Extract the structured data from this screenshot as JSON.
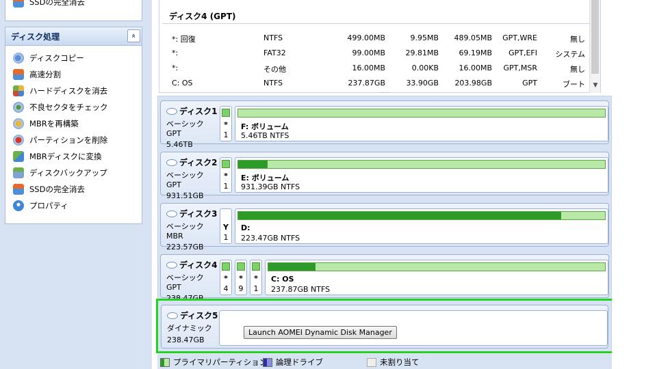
{
  "sidebar": {
    "top_item_label": "SSDの完全消去",
    "section_title": "ディスク処理",
    "collapse_glyph": "»",
    "items": [
      {
        "label": "ディスクコピー",
        "icon": "disk-copy-icon"
      },
      {
        "label": "高速分割",
        "icon": "quick-partition-icon"
      },
      {
        "label": "ハードディスクを消去",
        "icon": "wipe-disk-icon"
      },
      {
        "label": "不良セクタをチェック",
        "icon": "bad-sector-icon"
      },
      {
        "label": "MBRを再構築",
        "icon": "rebuild-mbr-icon"
      },
      {
        "label": "パーティションを削除",
        "icon": "delete-partition-icon"
      },
      {
        "label": "MBRディスクに変換",
        "icon": "convert-mbr-icon"
      },
      {
        "label": "ディスクバックアップ",
        "icon": "disk-backup-icon"
      },
      {
        "label": "SSDの完全消去",
        "icon": "ssd-erase-icon"
      },
      {
        "label": "プロパティ",
        "icon": "properties-icon"
      }
    ]
  },
  "partition_table": {
    "title": "ディスク4 (GPT)",
    "rows": [
      {
        "name": "*: 回復",
        "fs": "NTFS",
        "capacity": "499.00MB",
        "used": "9.95MB",
        "free": "489.05MB",
        "flag": "GPT,WRE",
        "status": "無し"
      },
      {
        "name": "*:",
        "fs": "FAT32",
        "capacity": "99.00MB",
        "used": "29.81MB",
        "free": "69.19MB",
        "flag": "GPT,EFI",
        "status": "システム"
      },
      {
        "name": "*:",
        "fs": "その他",
        "capacity": "16.00MB",
        "used": "0.00KB",
        "free": "16.00MB",
        "flag": "GPT,MSR",
        "status": "無し"
      },
      {
        "name": "C: OS",
        "fs": "NTFS",
        "capacity": "237.87GB",
        "used": "33.90GB",
        "free": "203.98GB",
        "flag": "GPT",
        "status": "ブート"
      }
    ]
  },
  "disks": [
    {
      "name": "ディスク1",
      "type": "ベーシック GPT",
      "size": "5.46TB",
      "small_parts": [
        {
          "l1": "*",
          "l2": "1"
        }
      ],
      "main": {
        "label": "F: ボリューム",
        "detail": "5.46TB NTFS",
        "used_fraction": 0.0
      }
    },
    {
      "name": "ディスク2",
      "type": "ベーシック GPT",
      "size": "931.51GB",
      "small_parts": [
        {
          "l1": "*",
          "l2": "1"
        }
      ],
      "main": {
        "label": "E: ボリューム",
        "detail": "931.39GB NTFS",
        "used_fraction": 0.08
      }
    },
    {
      "name": "ディスク3",
      "type": "ベーシック MBR",
      "size": "223.57GB",
      "small_parts": [
        {
          "l1": "Y",
          "l2": "1"
        }
      ],
      "main": {
        "label": "D:",
        "detail": "223.47GB NTFS",
        "used_fraction": 0.88
      }
    },
    {
      "name": "ディスク4",
      "type": "ベーシック GPT",
      "size": "238.47GB",
      "small_parts": [
        {
          "l1": "*",
          "l2": "4"
        },
        {
          "l1": "*",
          "l2": "9"
        },
        {
          "l1": "*",
          "l2": "1"
        }
      ],
      "main": {
        "label": "C: OS",
        "detail": "237.87GB NTFS",
        "used_fraction": 0.14
      }
    },
    {
      "name": "ディスク5",
      "type": "ダイナミック",
      "size": "238.47GB"
    }
  ],
  "dynamic_disk_button": "Launch AOMEI Dynamic Disk Manager",
  "legend": {
    "primary": "プライマリパーティション",
    "logical": "論理ドライブ",
    "unallocated": "未割り当て"
  },
  "colors": {
    "primary": "#6fc85a",
    "logical": "#4a4fc0",
    "unallocated": "#efefe9",
    "highlight": "#22d322"
  }
}
